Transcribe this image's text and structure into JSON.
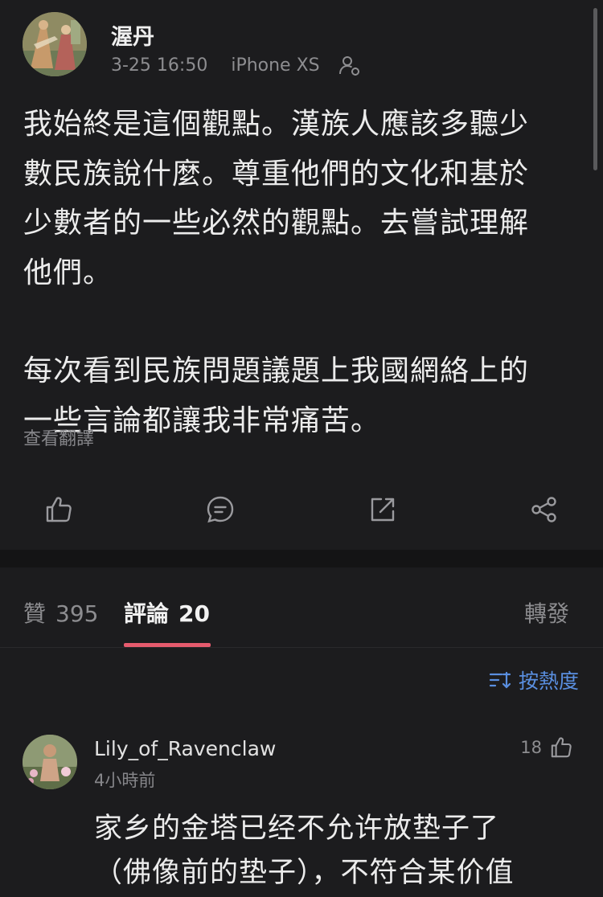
{
  "post": {
    "username": "渥丹",
    "time": "3-25 16:50",
    "device": "iPhone XS",
    "paragraphs": [
      [
        "我始終是這個觀點。漢族人應該多聽少",
        "數民族說什麼。尊重他們的文化和基於",
        "少數者的一些必然的觀點。去嘗試理解",
        "他們。"
      ],
      [
        "每次看到民族問題議題上我國網絡上的",
        "一些言論都讓我非常痛苦。"
      ]
    ],
    "translate_label": "查看翻譯",
    "actions": [
      "like-icon",
      "comment-icon",
      "share-out-icon",
      "share-icon"
    ]
  },
  "tabs": {
    "likes_label": "贊",
    "likes_count": "395",
    "comments_label": "評論",
    "comments_count": "20",
    "repost_label": "轉發"
  },
  "sort": {
    "label": "按熱度"
  },
  "comment": {
    "username": "Lily_of_Ravenclaw",
    "time": "4小時前",
    "likes": "18",
    "lines": [
      "家乡的金塔已经不允许放垫子了",
      "（佛像前的垫子），不符合某价值"
    ]
  },
  "colors": {
    "accent": "#e65b6e",
    "link": "#5a8fe0",
    "background": "#1c1c1e"
  }
}
